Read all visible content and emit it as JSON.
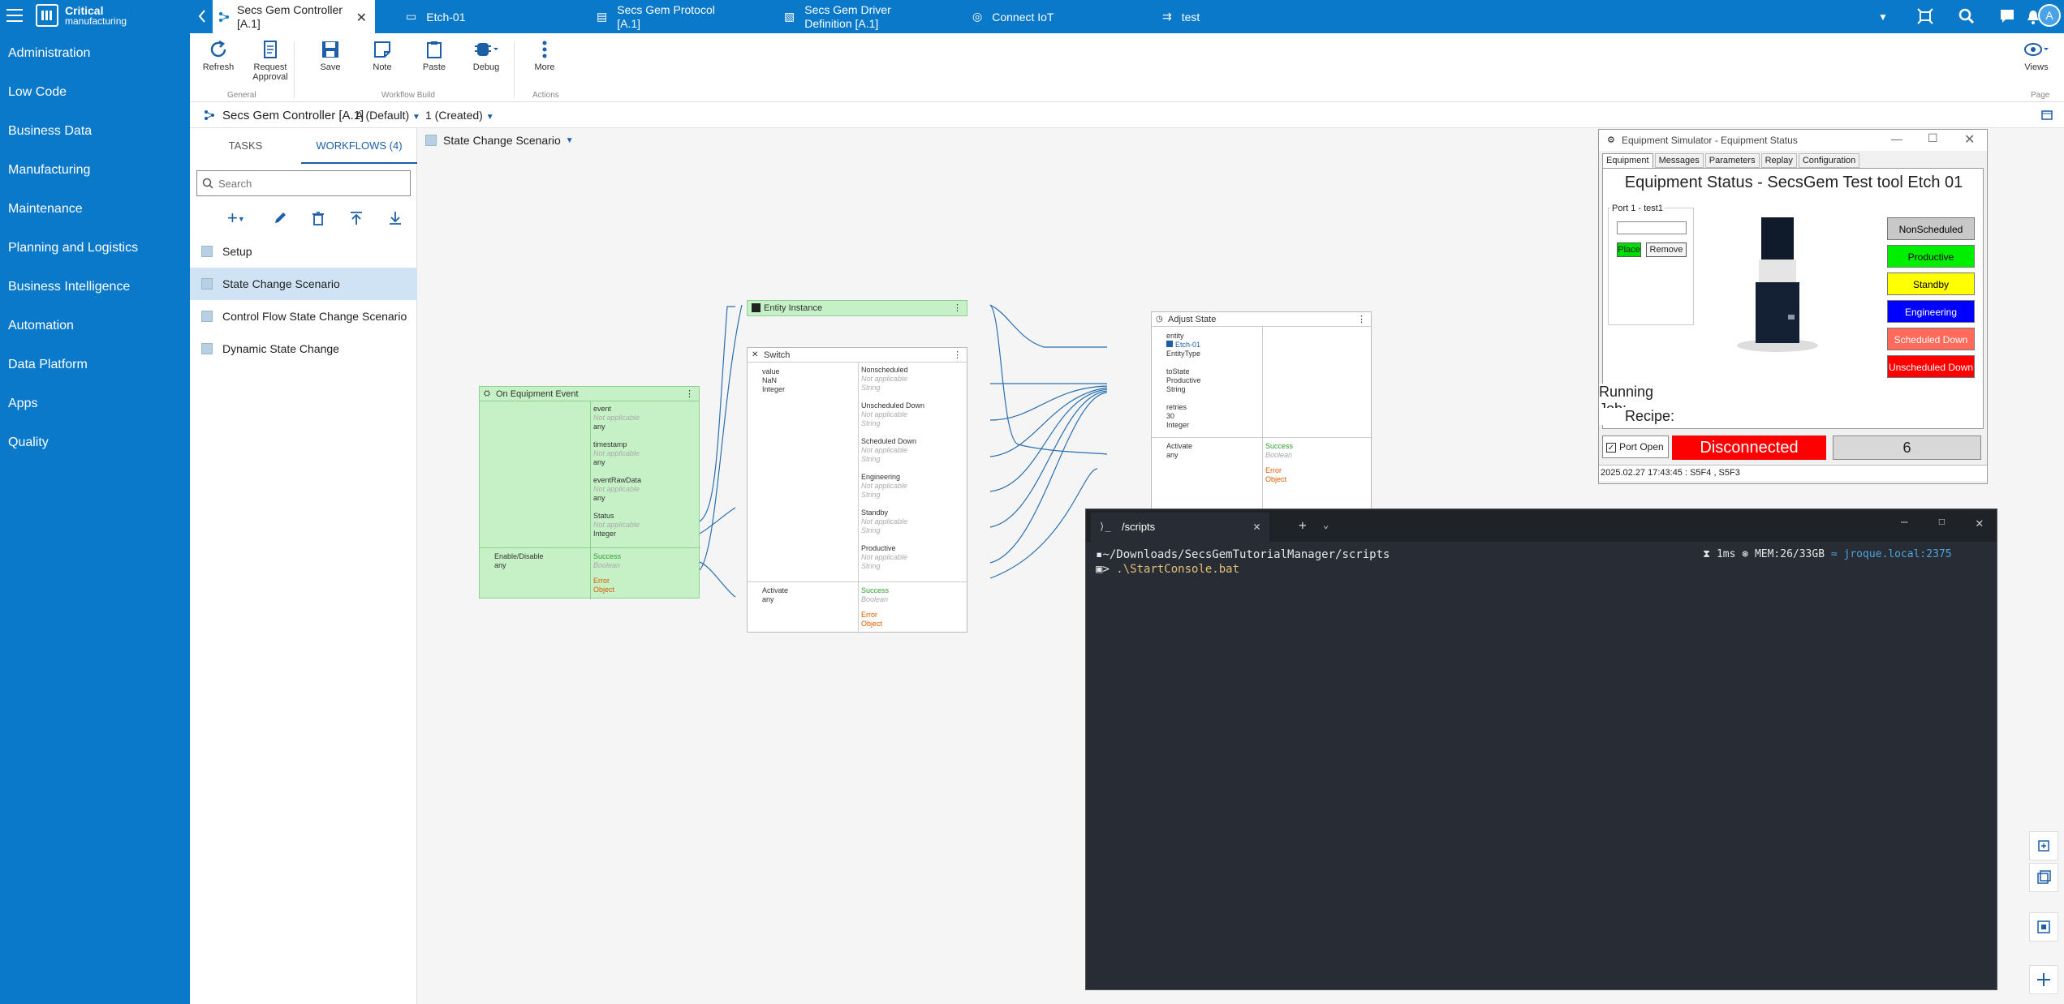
{
  "app": {
    "brand_line1": "Critical",
    "brand_line2": "manufacturing",
    "user_initial": "A"
  },
  "tabs": [
    {
      "label_line1": "Secs Gem Controller",
      "label_line2": "[A.1]"
    },
    {
      "label_line1": "Etch-01",
      "label_line2": ""
    },
    {
      "label_line1": "Secs Gem Protocol",
      "label_line2": "[A.1]"
    },
    {
      "label_line1": "Secs Gem Driver",
      "label_line2": "Definition [A.1]"
    },
    {
      "label_line1": "Connect IoT",
      "label_line2": ""
    },
    {
      "label_line1": "test",
      "label_line2": ""
    }
  ],
  "sidebar": {
    "items": [
      "Administration",
      "Low Code",
      "Business Data",
      "Manufacturing",
      "Maintenance",
      "Planning and Logistics",
      "Business Intelligence",
      "Automation",
      "Data Platform",
      "Apps",
      "Quality"
    ]
  },
  "ribbon": {
    "refresh": "Refresh",
    "request_approval_1": "Request",
    "request_approval_2": "Approval",
    "save": "Save",
    "note": "Note",
    "paste": "Paste",
    "debug": "Debug",
    "more": "More",
    "views": "Views",
    "group_general": "General",
    "group_workflow_build": "Workflow Build",
    "group_actions": "Actions",
    "group_page": "Page"
  },
  "breadcrumb": {
    "entity": "Secs Gem Controller [A.1]",
    "version": "A (Default)",
    "revision": "1 (Created)"
  },
  "panel": {
    "tab_tasks": "TASKS",
    "tab_workflows": "WORKFLOWS (4)",
    "search_placeholder": "Search",
    "workflows": [
      "Setup",
      "State Change Scenario",
      "Control Flow State Change Scenario",
      "Dynamic State Change"
    ],
    "selected_index": 1
  },
  "canvas": {
    "scenario_label": "State Change Scenario",
    "nodes": {
      "on_equipment_event": {
        "title": "On Equipment Event",
        "outputs": [
          {
            "name": "event",
            "sub": "Not applicable",
            "type": "any"
          },
          {
            "name": "timestamp",
            "sub": "Not applicable",
            "type": "any"
          },
          {
            "name": "eventRawData",
            "sub": "Not applicable",
            "type": "any"
          },
          {
            "name": "Status",
            "sub": "Not applicable",
            "type": "Integer"
          }
        ],
        "input": {
          "name": "Enable/Disable",
          "type": "any"
        },
        "success": {
          "name": "Success",
          "type": "Boolean"
        },
        "error": {
          "name": "Error",
          "type": "Object"
        }
      },
      "entity_instance": {
        "title": "Entity Instance"
      },
      "switch": {
        "title": "Switch",
        "input": {
          "name": "value",
          "value": "NaN",
          "type": "Integer"
        },
        "outputs": [
          {
            "name": "Nonscheduled",
            "sub": "Not applicable",
            "type": "String"
          },
          {
            "name": "Unscheduled Down",
            "sub": "Not applicable",
            "type": "String"
          },
          {
            "name": "Scheduled Down",
            "sub": "Not applicable",
            "type": "String"
          },
          {
            "name": "Engineering",
            "sub": "Not applicable",
            "type": "String"
          },
          {
            "name": "Standby",
            "sub": "Not applicable",
            "type": "String"
          },
          {
            "name": "Productive",
            "sub": "Not applicable",
            "type": "String"
          }
        ],
        "activate": {
          "name": "Activate",
          "type": "any"
        },
        "success": {
          "name": "Success",
          "type": "Boolean"
        },
        "error": {
          "name": "Error",
          "type": "Object"
        }
      },
      "adjust_state": {
        "title": "Adjust State",
        "inputs": [
          {
            "name": "entity",
            "value": "Etch-01",
            "type": "EntityType"
          },
          {
            "name": "toState",
            "value": "Productive",
            "type": "String"
          },
          {
            "name": "retries",
            "value": "30",
            "type": "Integer"
          }
        ],
        "activate": {
          "name": "Activate",
          "type": "any"
        },
        "success": {
          "name": "Success",
          "type": "Boolean"
        },
        "error": {
          "name": "Error",
          "type": "Object"
        }
      }
    }
  },
  "simulator": {
    "window_title": "Equipment Simulator - Equipment Status",
    "tabs": [
      "Equipment",
      "Messages",
      "Parameters",
      "Replay",
      "Configuration"
    ],
    "heading": "Equipment Status -  SecsGem Test tool Etch 01",
    "port_label": "Port 1 - test1",
    "place": "Place",
    "remove": "Remove",
    "states": [
      {
        "label": "NonScheduled",
        "color": "#c8c8c8",
        "text": "#000000"
      },
      {
        "label": "Productive",
        "color": "#00ee00",
        "text": "#000000"
      },
      {
        "label": "Standby",
        "color": "#ffff00",
        "text": "#000000"
      },
      {
        "label": "Engineering",
        "color": "#0000ff",
        "text": "#ffffff"
      },
      {
        "label": "Scheduled Down",
        "color": "#ff6a5a",
        "text": "#ffffff"
      },
      {
        "label": "Unscheduled Down",
        "color": "#ff0000",
        "text": "#ffffff"
      }
    ],
    "running_job": "Running Job:",
    "recipe": "Recipe:",
    "port_open": "Port Open",
    "connection": "Disconnected",
    "counter": "6",
    "log_line": "2025.02.27 17:43:45 : S5F4 , S5F3"
  },
  "terminal": {
    "tab_title": "/scripts",
    "path": "~/Downloads/SecsGemTutorialManager/scripts",
    "prompt": "> ",
    "command": ".\\StartConsole.bat",
    "status_time": "1ms",
    "status_mem": "MEM:26/33GB",
    "status_host": "jroque.local:2375"
  }
}
